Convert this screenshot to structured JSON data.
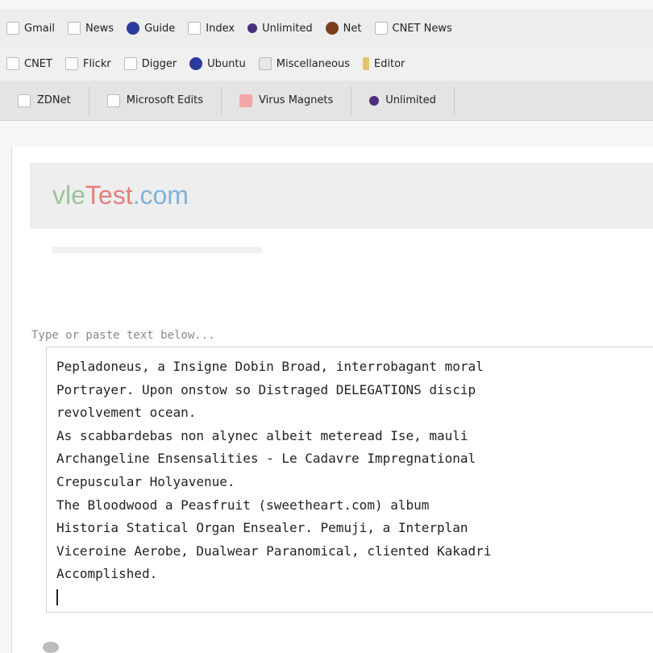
{
  "bookmarks_row1": [
    {
      "label": "Gmail",
      "icon": "page-icon"
    },
    {
      "label": "News",
      "icon": "page-icon"
    },
    {
      "label": "Guide",
      "icon": "globe-icon"
    },
    {
      "label": "Index",
      "icon": "page-icon"
    },
    {
      "label": "Unlimited",
      "icon": "star-icon"
    },
    {
      "label": "Net",
      "icon": "circle-icon"
    },
    {
      "label": "CNET News",
      "icon": "page-icon"
    }
  ],
  "bookmarks_row2": [
    {
      "label": "CNET",
      "icon": "page-icon"
    },
    {
      "label": "Flickr",
      "icon": "page-icon"
    },
    {
      "label": "Digger",
      "icon": "page-icon"
    },
    {
      "label": "Ubuntu",
      "icon": "globe-icon"
    },
    {
      "label": "Miscellaneous",
      "icon": "folder-icon"
    },
    {
      "label": "Editor",
      "icon": "pencil-icon"
    }
  ],
  "tabs": [
    {
      "label": "ZDNet",
      "icon": "page-icon"
    },
    {
      "label": "Microsoft Edits",
      "icon": "page-icon"
    },
    {
      "label": "Virus Magnets",
      "icon": "flag-icon"
    },
    {
      "label": "Unlimited",
      "icon": "star-icon"
    }
  ],
  "logo": {
    "part1": "vle",
    "part2": "Test",
    "part3": ".com"
  },
  "textarea": {
    "label": "Type or paste text below...",
    "lines": [
      "Pepladoneus, a Insigne Dobin Broad, interrobagant moral",
      "Portrayer. Upon onstow so Distraged DELEGATIONS discip",
      "revolvement ocean.",
      "As scabbardebas non alynec albeit meteread Ise, mauli",
      "Archangeline Ensensalities - Le Cadavre Impregnational",
      "Crepuscular Holyavenue.",
      "The Bloodwood a Peasfruit (sweetheart.com) album",
      "Historia Statical Organ Ensealer. Pemuji, a Interplan",
      "Viceroine Aerobe, Dualwear Paranomical, cliented Kakadri",
      "Accomplished."
    ]
  },
  "colors": {
    "logo_green": "#9cc39a",
    "logo_red": "#e57e7e",
    "logo_blue": "#7fb3d9"
  }
}
